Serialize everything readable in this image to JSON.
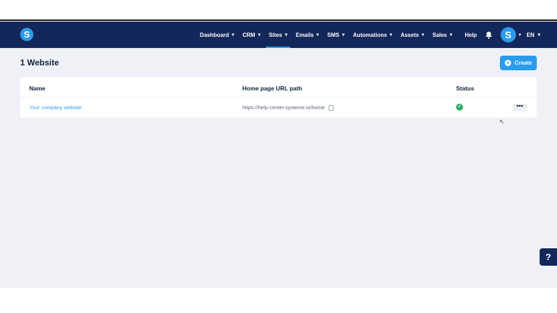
{
  "app": {
    "logo_letter": "S"
  },
  "nav": {
    "items": [
      {
        "label": "Dashboard"
      },
      {
        "label": "CRM"
      },
      {
        "label": "Sites"
      },
      {
        "label": "Emails"
      },
      {
        "label": "SMS"
      },
      {
        "label": "Automations"
      },
      {
        "label": "Assets"
      },
      {
        "label": "Sales"
      }
    ],
    "active": "Sites",
    "help_label": "Help",
    "avatar_letter": "S",
    "language": "EN"
  },
  "page": {
    "title": "1 Website",
    "create_label": "Create"
  },
  "table": {
    "headers": {
      "name": "Name",
      "url": "Home page URL path",
      "status": "Status"
    },
    "rows": [
      {
        "name": "Your company website",
        "url": "https://help-center.systeme.io/home",
        "status": "active"
      }
    ],
    "more_label": "•••"
  },
  "help_fab_label": "?",
  "colors": {
    "navbar": "#14275a",
    "accent": "#2a9cf0",
    "success": "#27ae60",
    "background": "#eff1f6"
  }
}
